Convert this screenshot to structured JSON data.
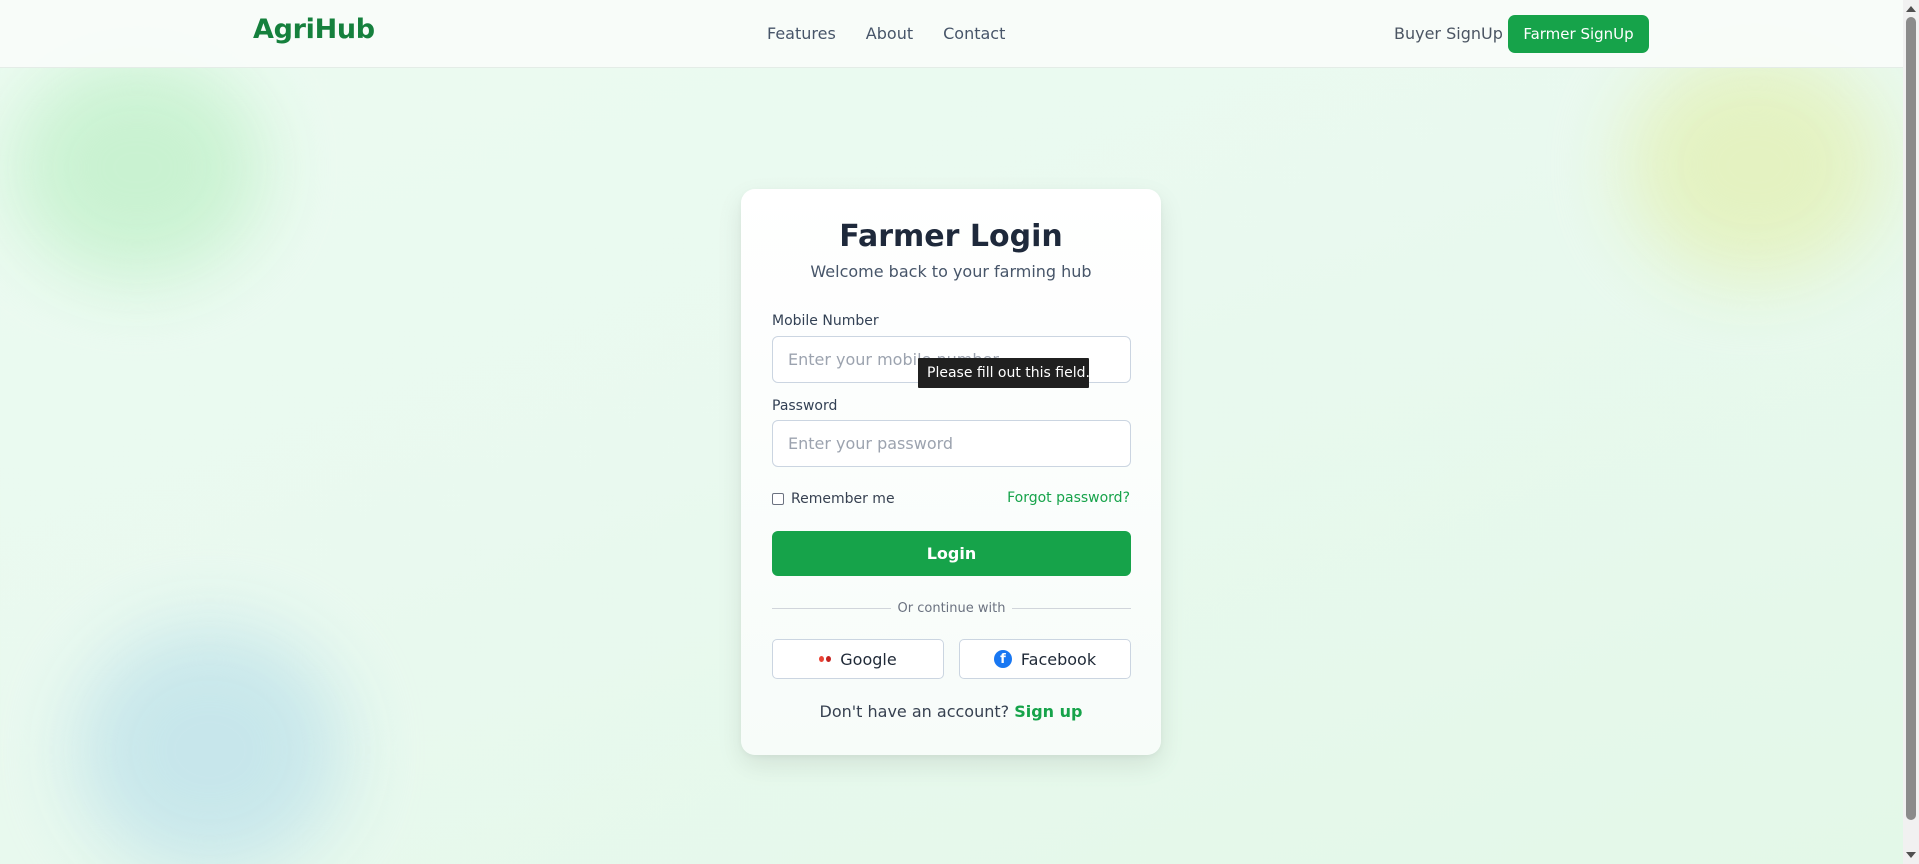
{
  "header": {
    "logo": "AgriHub",
    "nav": [
      {
        "label": "Features"
      },
      {
        "label": "About"
      },
      {
        "label": "Contact"
      }
    ],
    "buyer_signup": "Buyer SignUp",
    "farmer_signup": "Farmer SignUp"
  },
  "card": {
    "title": "Farmer Login",
    "subtitle": "Welcome back to your farming hub",
    "mobile_label": "Mobile Number",
    "mobile_placeholder": "Enter your mobile number",
    "mobile_value": "",
    "password_label": "Password",
    "password_placeholder": "Enter your password",
    "password_value": "",
    "validation_tooltip": "Please fill out this field.",
    "remember_me": "Remember me",
    "remember_checked": false,
    "forgot_password": "Forgot password?",
    "login_button": "Login",
    "divider_text": "Or continue with",
    "google_button": "Google",
    "facebook_button": "Facebook",
    "signup_prompt": "Don't have an account?",
    "signup_link": "Sign up"
  },
  "colors": {
    "brand": "#15803d",
    "accent": "#16a34a",
    "background": "#e9f9ef",
    "facebook": "#1877f2",
    "google_red": "#ea4335"
  },
  "icons": {
    "google": "google-icon",
    "facebook": "facebook-icon"
  }
}
